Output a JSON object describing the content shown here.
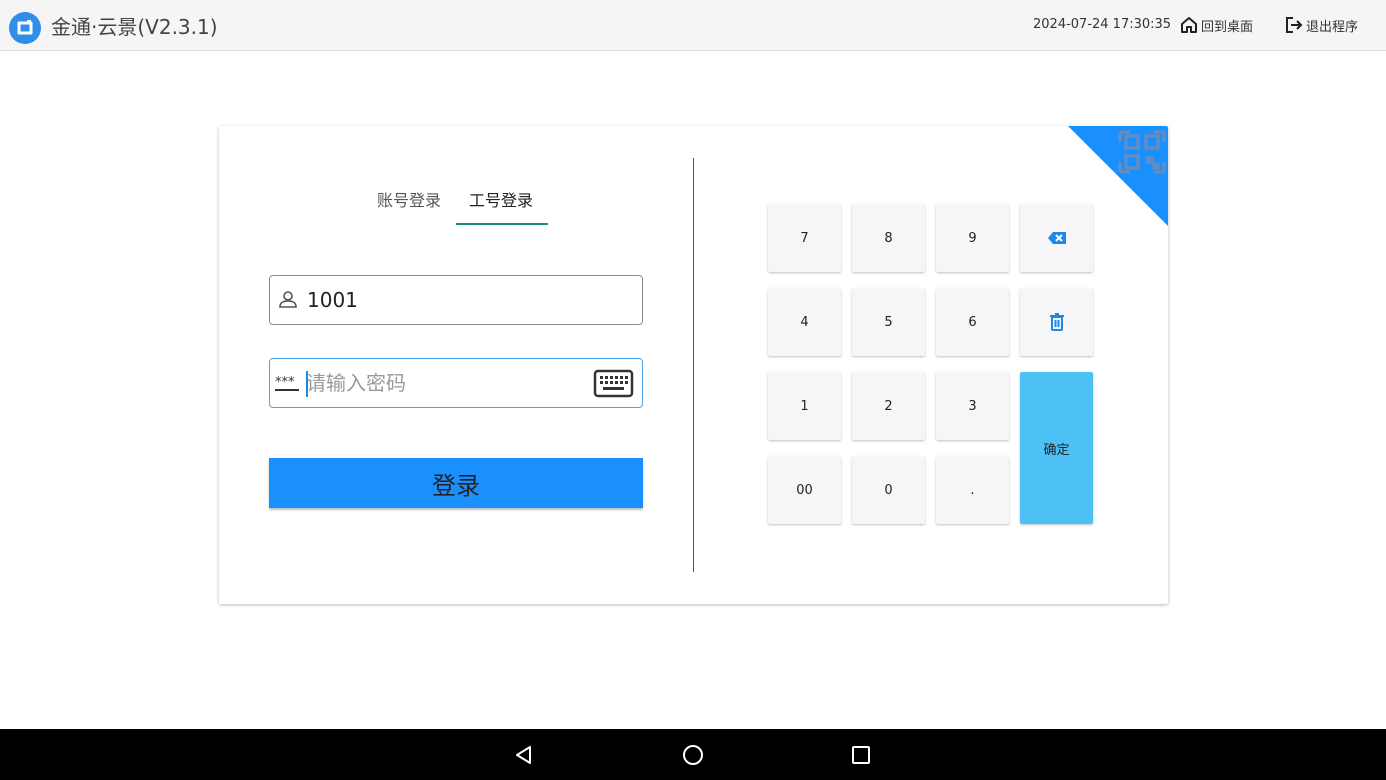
{
  "header": {
    "app_title": "金通·云景(V2.3.1)",
    "datetime": "2024-07-24 17:30:35",
    "home_label": "回到桌面",
    "exit_label": "退出程序"
  },
  "login": {
    "tabs": [
      {
        "label": "账号登录",
        "active": false
      },
      {
        "label": "工号登录",
        "active": true
      }
    ],
    "employee_id_value": "1001",
    "password_placeholder": "请输入密码",
    "password_prefix_icon_text": "***",
    "login_button_label": "登录"
  },
  "keypad": {
    "keys": [
      "7",
      "8",
      "9",
      "4",
      "5",
      "6",
      "1",
      "2",
      "3",
      "00",
      "0",
      "."
    ],
    "confirm_label": "确定",
    "icons": [
      "backspace-icon",
      "trash-icon"
    ]
  },
  "colors": {
    "accent_blue": "#1a90ff",
    "confirm_blue": "#4dc0f5",
    "tab_underline": "#1f8f82",
    "icon_blue": "#1e88e5"
  }
}
